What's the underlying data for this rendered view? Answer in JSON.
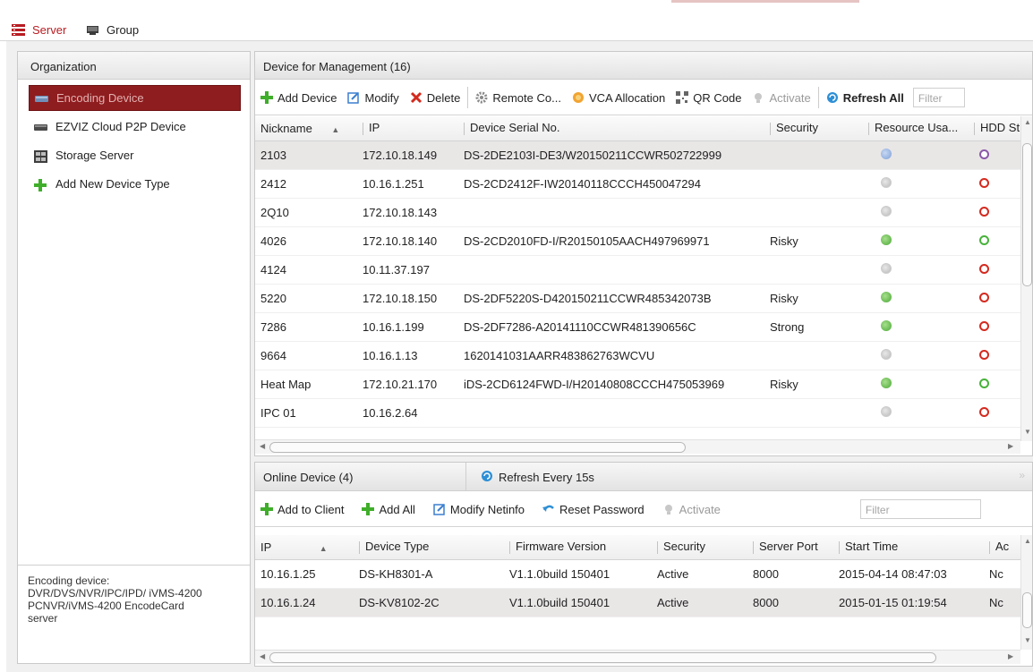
{
  "tabs": [
    {
      "label": "Server",
      "active": true,
      "icon": "server-icon"
    },
    {
      "label": "Group",
      "active": false,
      "icon": "group-icon"
    }
  ],
  "organization": {
    "title": "Organization",
    "items": [
      {
        "label": "Encoding Device",
        "selected": true,
        "icon": "encoding-device-icon"
      },
      {
        "label": "EZVIZ Cloud P2P Device",
        "selected": false,
        "icon": "cloud-device-icon"
      },
      {
        "label": "Storage Server",
        "selected": false,
        "icon": "storage-server-icon"
      },
      {
        "label": "Add New Device Type",
        "selected": false,
        "icon": "plus-icon"
      }
    ],
    "description_lines": [
      "Encoding device:",
      "DVR/DVS/NVR/IPC/IPD/ iVMS-4200",
      "PCNVR/iVMS-4200 EncodeCard",
      "server"
    ]
  },
  "device_panel": {
    "title": "Device for Management (16)",
    "toolbar": {
      "add_device": "Add Device",
      "modify": "Modify",
      "delete": "Delete",
      "remote_config": "Remote Co...",
      "vca_allocation": "VCA Allocation",
      "qr_code": "QR Code",
      "activate": "Activate",
      "refresh_all": "Refresh All",
      "filter_placeholder": "Filter"
    },
    "columns": [
      "Nickname",
      "IP",
      "Device Serial No.",
      "Security",
      "Resource Usa...",
      "HDD St"
    ],
    "rows": [
      {
        "nickname": "2103",
        "ip": "172.10.18.149",
        "serial": "DS-2DE2103I-DE3/W20150211CCWR502722999",
        "security": "",
        "resource": "blue",
        "hdd": "purple"
      },
      {
        "nickname": "2412",
        "ip": "10.16.1.251",
        "serial": "DS-2CD2412F-IW20140118CCCH450047294",
        "security": "",
        "resource": "gray",
        "hdd": "red"
      },
      {
        "nickname": "2Q10",
        "ip": "172.10.18.143",
        "serial": "",
        "security": "",
        "resource": "gray",
        "hdd": "red"
      },
      {
        "nickname": "4026",
        "ip": "172.10.18.140",
        "serial": "DS-2CD2010FD-I/R20150105AACH497969971",
        "security": "Risky",
        "resource": "green",
        "hdd": "green"
      },
      {
        "nickname": "4124",
        "ip": "10.11.37.197",
        "serial": "",
        "security": "",
        "resource": "gray",
        "hdd": "red"
      },
      {
        "nickname": "5220",
        "ip": "172.10.18.150",
        "serial": "DS-2DF5220S-D420150211CCWR485342073B",
        "security": "Risky",
        "resource": "green",
        "hdd": "red"
      },
      {
        "nickname": "7286",
        "ip": "10.16.1.199",
        "serial": "DS-2DF7286-A20141110CCWR481390656C",
        "security": "Strong",
        "resource": "green",
        "hdd": "red"
      },
      {
        "nickname": "9664",
        "ip": "10.16.1.13",
        "serial": "1620141031AARR483862763WCVU",
        "security": "",
        "resource": "gray",
        "hdd": "red"
      },
      {
        "nickname": "Heat Map",
        "ip": "172.10.21.170",
        "serial": "iDS-2CD6124FWD-I/H20140808CCCH475053969",
        "security": "Risky",
        "resource": "green",
        "hdd": "green"
      },
      {
        "nickname": "IPC 01",
        "ip": "10.16.2.64",
        "serial": "",
        "security": "",
        "resource": "gray",
        "hdd": "red"
      }
    ]
  },
  "online_panel": {
    "title": "Online Device (4)",
    "refresh": "Refresh Every 15s",
    "toolbar": {
      "add_to_client": "Add to Client",
      "add_all": "Add All",
      "modify_netinfo": "Modify Netinfo",
      "reset_password": "Reset Password",
      "activate": "Activate",
      "filter_placeholder": "Filter"
    },
    "columns": [
      "IP",
      "Device Type",
      "Firmware Version",
      "Security",
      "Server Port",
      "Start Time",
      "Ac"
    ],
    "rows": [
      {
        "ip": "10.16.1.25",
        "type": "DS-KH8301-A",
        "firmware": "V1.1.0build 150401",
        "security": "Active",
        "port": "8000",
        "start": "2015-04-14 08:47:03",
        "added": "Nc"
      },
      {
        "ip": "10.16.1.24",
        "type": "DS-KV8102-2C",
        "firmware": "V1.1.0build 150401",
        "security": "Active",
        "port": "8000",
        "start": "2015-01-15 01:19:54",
        "added": "Nc"
      }
    ]
  },
  "colors": {
    "accent": "#b81c22",
    "selected_bg": "#8e1d1f"
  }
}
